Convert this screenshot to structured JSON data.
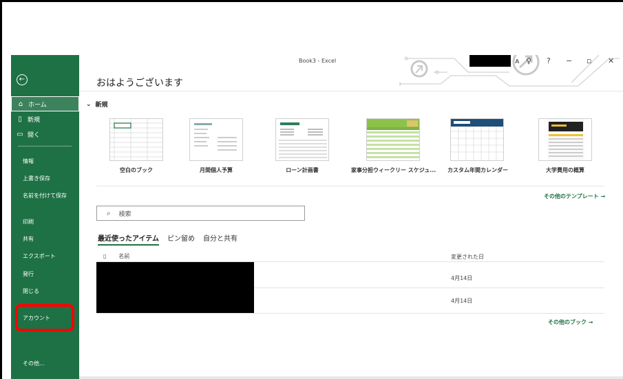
{
  "window": {
    "title": "Book3  -  Excel"
  },
  "sidebar": {
    "back_icon": "back-arrow-icon",
    "items": [
      {
        "label": "ホーム",
        "icon": "home-icon"
      },
      {
        "label": "新規",
        "icon": "new-doc-icon"
      },
      {
        "label": "開く",
        "icon": "folder-open-icon"
      }
    ],
    "subitems": [
      "情報",
      "上書き保存",
      "名前を付けて保存",
      "印刷",
      "共有",
      "エクスポート",
      "発行",
      "閉じる",
      "アカウント",
      "その他..."
    ]
  },
  "main": {
    "greeting": "おはようございます",
    "new_section": "新規",
    "templates": [
      "空白のブック",
      "月間個人予算",
      "ローン計画書",
      "家事分担ウィークリー スケジュ...",
      "カスタム年間カレンダー",
      "大学費用の概算"
    ],
    "more_templates": "その他のテンプレート  →",
    "search": {
      "placeholder": "検索"
    },
    "tabs": [
      "最近使ったアイテム",
      "ピン留め",
      "自分と共有"
    ],
    "list": {
      "col_name": "名前",
      "col_date": "変更された日",
      "rows": [
        {
          "date": "4月14日"
        },
        {
          "date": "4月14日"
        }
      ]
    },
    "more_books": "その他のブック  →"
  },
  "colors": {
    "accent": "#1e7145",
    "highlight": "#ff0000"
  }
}
